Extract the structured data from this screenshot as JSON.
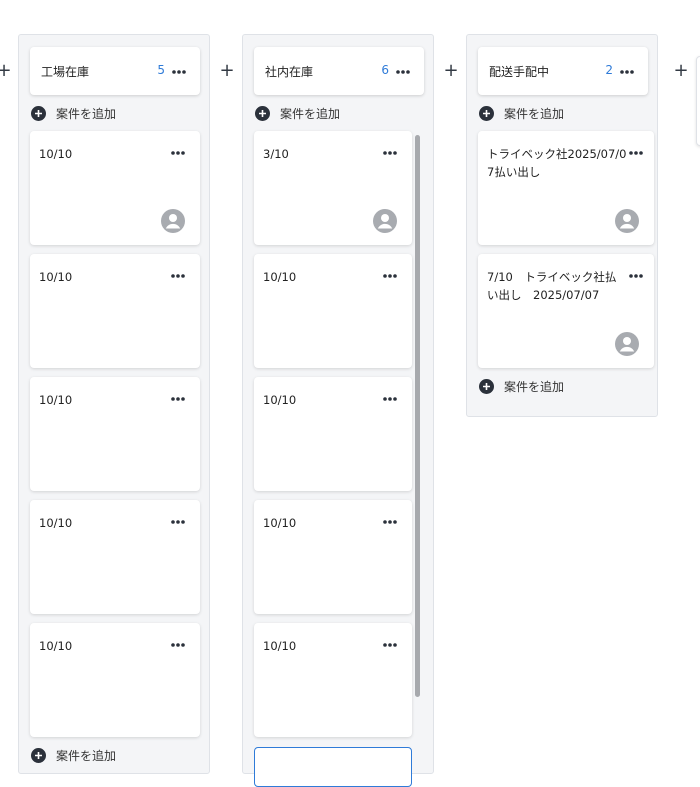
{
  "add_column_icon": "plus-icon",
  "more_icon": "ellipsis-icon",
  "add_case_icon": "plus-circle-icon",
  "avatar_icon": "user-avatar-icon",
  "colors": {
    "accent": "#2f7bd8",
    "column_bg": "#f4f5f7",
    "icon_dark": "#2b313b",
    "avatar_gray": "#a8abb0"
  },
  "columns": [
    {
      "title": "工場在庫",
      "count": "5",
      "top_add_label": "案件を追加",
      "bottom_add_label": "案件を追加",
      "cards": [
        {
          "title": "10/10"
        },
        {
          "title": "10/10"
        },
        {
          "title": "10/10"
        },
        {
          "title": "10/10"
        },
        {
          "title": "10/10"
        }
      ]
    },
    {
      "title": "社内在庫",
      "count": "6",
      "top_add_label": "案件を追加",
      "cards": [
        {
          "title": "3/10"
        },
        {
          "title": "10/10"
        },
        {
          "title": "10/10"
        },
        {
          "title": "10/10"
        },
        {
          "title": "10/10"
        }
      ]
    },
    {
      "title": "配送手配中",
      "count": "2",
      "top_add_label": "案件を追加",
      "bottom_add_label": "案件を追加",
      "cards": [
        {
          "title": "トライベック社2025/07/07払い出し"
        },
        {
          "title": "7/10　トライベック社払い出し　2025/07/07"
        }
      ]
    }
  ]
}
